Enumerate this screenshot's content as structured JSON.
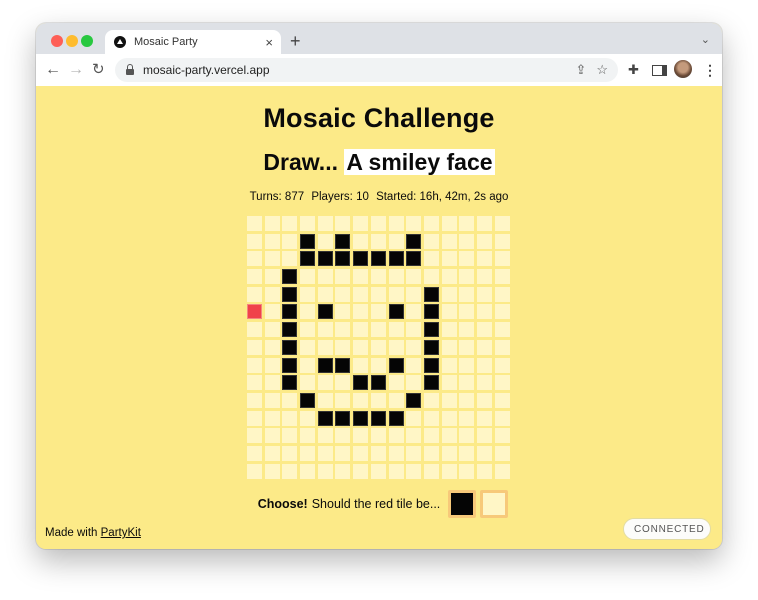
{
  "browser": {
    "tab": {
      "title": "Mosaic Party",
      "favicon": "triangle-logo-icon",
      "close": "×"
    },
    "new_tab": "+",
    "tab_menu": "⌄",
    "nav": {
      "back": "←",
      "forward": "→",
      "reload": "↻"
    },
    "url": "mosaic-party.vercel.app",
    "icons": {
      "share": "⇪",
      "bookmark": "☆",
      "extensions": "✚",
      "menu": "⋮"
    }
  },
  "page": {
    "title": "Mosaic Challenge",
    "prompt_prefix": "Draw...",
    "prompt_subject": "A smiley face",
    "stats": {
      "turns": "Turns: 877",
      "players": "Players: 10",
      "started": "Started: 16h, 42m, 2s ago"
    },
    "grid": {
      "columns": 15,
      "rows": [
        "...............",
        "...B.B...B.....",
        "...BBBBBBB.....",
        "..B............",
        "..B.......B....",
        "R.B.B...B.B....",
        "..B.......B....",
        "..B.......B....",
        "..B.BB..B.B....",
        "..B...BB..B....",
        "...B.....B.....",
        "....BBBBB......",
        "...............",
        "...............",
        "..............."
      ],
      "legend": {
        ".": "empty",
        "B": "black",
        "R": "red"
      }
    },
    "choose": {
      "label_bold": "Choose!",
      "label": "Should the red tile be...",
      "options": [
        "black",
        "empty"
      ]
    },
    "footer": {
      "prefix": "Made with",
      "link": "PartyKit"
    },
    "status": {
      "label": "CONNECTED",
      "color": "#22c55e"
    },
    "colors": {
      "background": "#fcea88",
      "tile_empty": "#fff6c6",
      "tile_black": "#050505",
      "tile_red": "#f0424a"
    }
  }
}
